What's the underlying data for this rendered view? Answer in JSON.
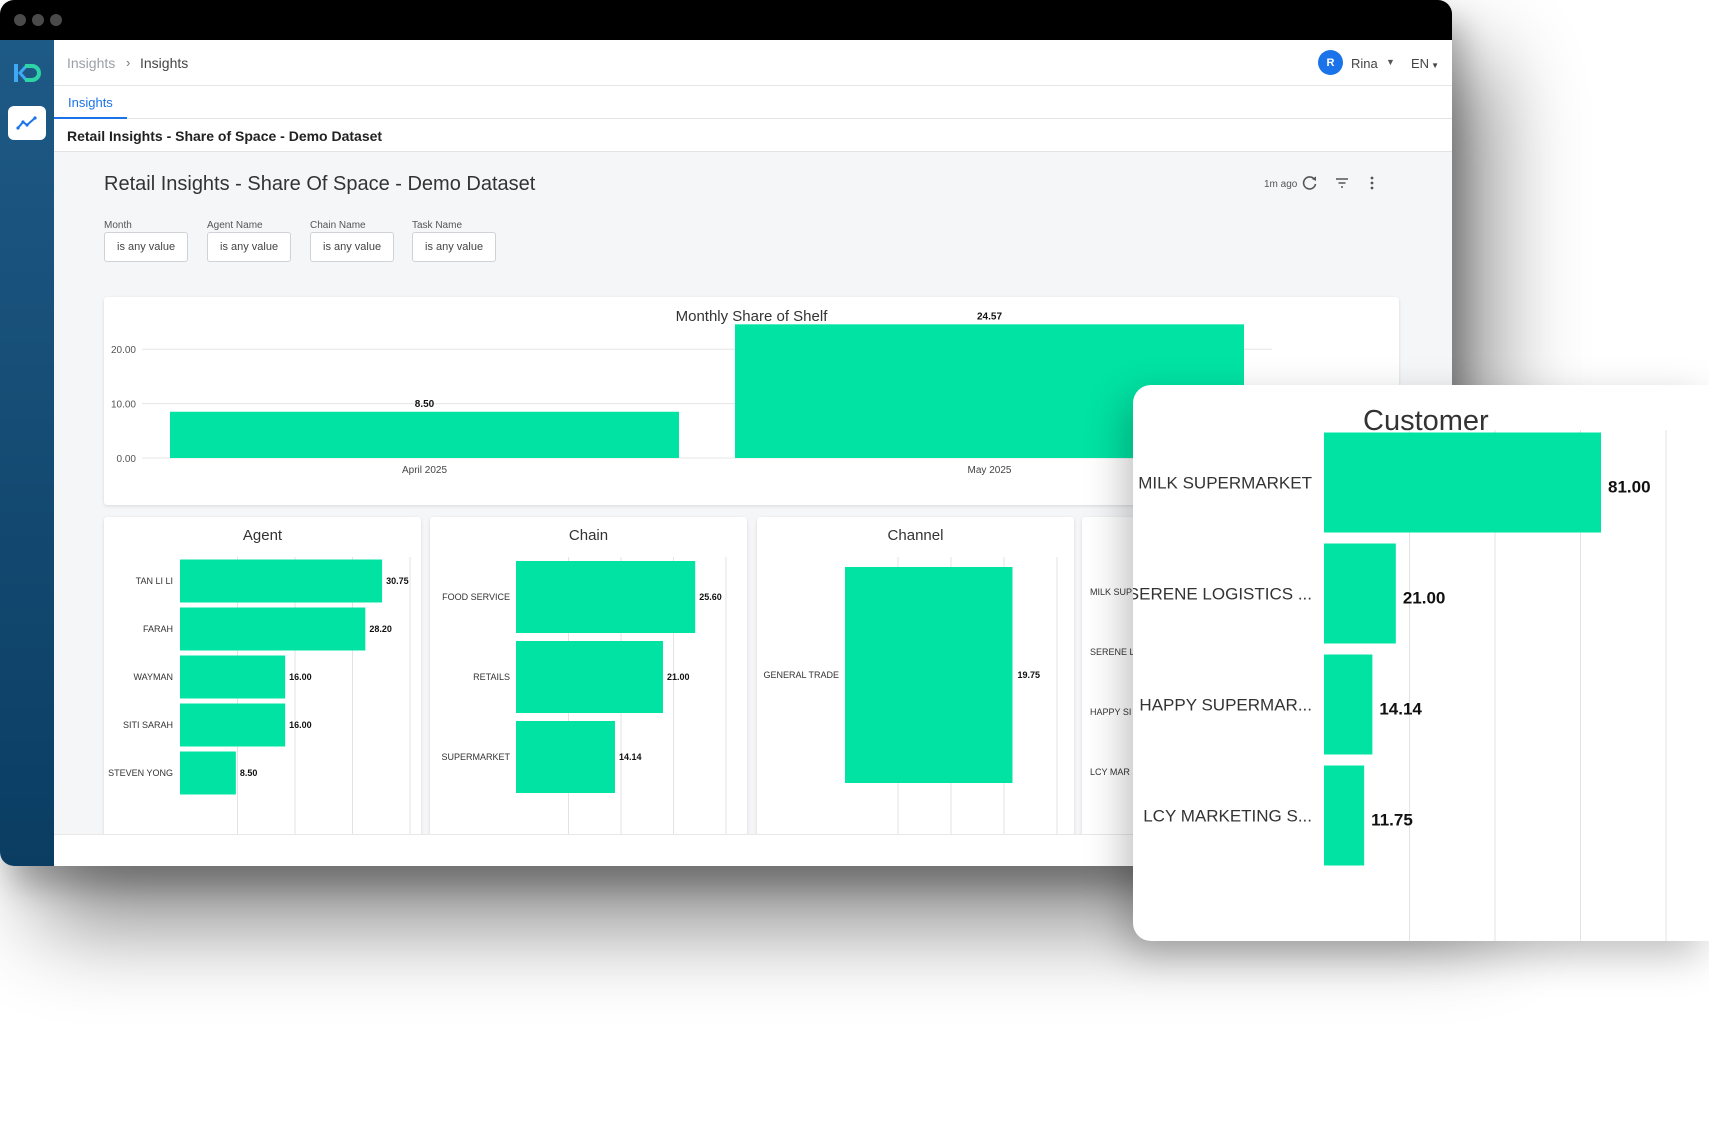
{
  "breadcrumb": {
    "parent": "Insights",
    "current": "Insights"
  },
  "user": {
    "initial": "R",
    "name": "Rina",
    "language": "EN"
  },
  "tabs": [
    {
      "label": "Insights"
    }
  ],
  "page_title": "Retail Insights - Share of Space - Demo Dataset",
  "dashboard": {
    "title": "Retail Insights - Share Of Space - Demo Dataset",
    "updated": "1m ago",
    "filters": [
      {
        "label": "Month",
        "value": "is any value"
      },
      {
        "label": "Agent Name",
        "value": "is any value"
      },
      {
        "label": "Chain Name",
        "value": "is any value"
      },
      {
        "label": "Task Name",
        "value": "is any value"
      }
    ]
  },
  "colors": {
    "bar": "#00e3a3",
    "accent": "#1a73e8",
    "sidebar": "#0b3d62"
  },
  "icons": [
    "logo-icon",
    "insights-chart-icon",
    "refresh-icon",
    "filter-icon",
    "more-vert-icon",
    "chevron-right-icon",
    "caret-down-icon"
  ],
  "chart_data": [
    {
      "id": "monthly",
      "type": "bar",
      "title": "Monthly Share of Shelf",
      "categories": [
        "April 2025",
        "May 2025"
      ],
      "values": [
        8.5,
        24.57
      ],
      "data_labels": [
        "8.50",
        "24.57"
      ],
      "y_ticks": [
        "0.00",
        "10.00",
        "20.00"
      ],
      "ylim": [
        0,
        25
      ],
      "grid": true
    },
    {
      "id": "agent",
      "type": "bar",
      "orientation": "horizontal",
      "title": "Agent",
      "categories": [
        "TAN LI LI",
        "FARAH",
        "WAYMAN",
        "SITI SARAH",
        "STEVEN YONG"
      ],
      "values": [
        30.75,
        28.2,
        16.0,
        16.0,
        8.5
      ],
      "data_labels": [
        "30.75",
        "28.20",
        "16.00",
        "16.00",
        "8.50"
      ],
      "xlim": [
        0,
        35
      ]
    },
    {
      "id": "chain",
      "type": "bar",
      "orientation": "horizontal",
      "title": "Chain",
      "categories": [
        "FOOD SERVICE",
        "RETAILS",
        "SUPERMARKET"
      ],
      "values": [
        25.6,
        21.0,
        14.14
      ],
      "data_labels": [
        "25.60",
        "21.00",
        "14.14"
      ],
      "xlim": [
        0,
        30
      ]
    },
    {
      "id": "channel",
      "type": "bar",
      "orientation": "horizontal",
      "title": "Channel",
      "categories": [
        "GENERAL TRADE"
      ],
      "values": [
        19.75
      ],
      "data_labels": [
        "19.75"
      ],
      "xlim": [
        0,
        25
      ]
    },
    {
      "id": "customer",
      "type": "bar",
      "orientation": "horizontal",
      "title": "Customer",
      "categories": [
        "MILK SUPERMARKET",
        "SERENE LOGISTICS ...",
        "HAPPY SUPERMAR...",
        "LCY MARKETING S..."
      ],
      "partial_labels": [
        "MILK SUP",
        "SERENE L",
        "HAPPY SI",
        "LCY MAR"
      ],
      "values": [
        81.0,
        21.0,
        14.14,
        11.75
      ],
      "data_labels": [
        "81.00",
        "21.00",
        "14.14",
        "11.75"
      ],
      "xlim": [
        0,
        100
      ]
    }
  ]
}
